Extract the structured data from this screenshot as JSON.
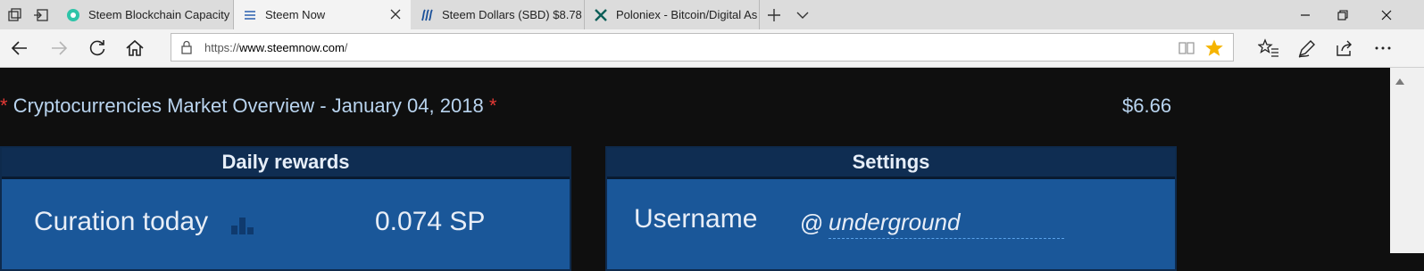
{
  "tabs": [
    {
      "title": "Steem Blockchain Capacity -",
      "favicon": "steem-logo-icon",
      "active": false
    },
    {
      "title": "Steem Now",
      "favicon": "list-page-icon",
      "active": true
    },
    {
      "title": "Steem Dollars (SBD) $8.78 (",
      "favicon": "steem-logo-icon",
      "active": false
    },
    {
      "title": "Poloniex - Bitcoin/Digital As",
      "favicon": "poloniex-icon",
      "active": false
    }
  ],
  "address": {
    "url_prefix": "https://",
    "url_host": "www.steemnow.com",
    "url_suffix": "/"
  },
  "page": {
    "headline": {
      "asterisk_left": "*",
      "text": "Cryptocurrencies Market Overview - January 04, 2018",
      "asterisk_right": "*"
    },
    "price": "$6.66",
    "daily_rewards": {
      "title": "Daily rewards",
      "row_label": "Curation today",
      "row_value": "0.074 SP"
    },
    "settings": {
      "title": "Settings",
      "username_label": "Username",
      "at_symbol": "@",
      "username_value": "underground"
    }
  },
  "colors": {
    "page_bg": "#0f0f0f",
    "panel_bg": "#1a5799",
    "panel_header_bg": "#0f2d52",
    "headline_text": "#b9d4ef",
    "asterisk": "#e53935",
    "star_active": "#f5b400"
  }
}
